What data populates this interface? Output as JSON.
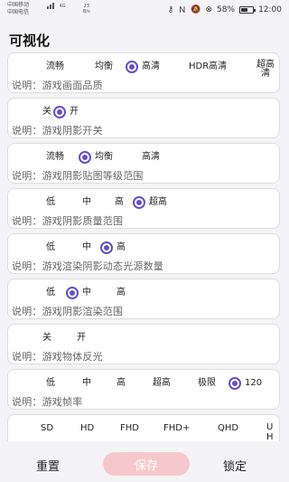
{
  "status_bar": {
    "carrier_1": "中国移动",
    "carrier_2": "中国电信",
    "net_type": "4G",
    "speed_value": "23",
    "speed_unit": "B/s",
    "battery": "58%",
    "battery_level": 0.58,
    "time": "12:00"
  },
  "page_title": "可视化",
  "settings": [
    {
      "options": [
        "流畅",
        "均衡",
        "高清",
        "HDR高清",
        "超高清"
      ],
      "selected": 2,
      "description": "说明：游戏画面品质"
    },
    {
      "options": [
        "关",
        "开"
      ],
      "selected": 1,
      "description": "说明：游戏阴影开关"
    },
    {
      "options": [
        "流畅",
        "均衡",
        "高清"
      ],
      "selected": 1,
      "description": "说明：游戏阴影贴图等级范围"
    },
    {
      "options": [
        "低",
        "中",
        "高",
        "超高"
      ],
      "selected": 3,
      "description": "说明：游戏阴影质量范围"
    },
    {
      "options": [
        "低",
        "中",
        "高"
      ],
      "selected": 2,
      "description": "说明：游戏渲染阴影动态光源数量"
    },
    {
      "options": [
        "低",
        "中",
        "高"
      ],
      "selected": 1,
      "description": "说明：游戏阴影渲染范围"
    },
    {
      "options": [
        "关",
        "开"
      ],
      "selected": -1,
      "description": "说明：游戏物体反光"
    },
    {
      "options": [
        "低",
        "中",
        "高",
        "超高",
        "极限",
        "120"
      ],
      "selected": 5,
      "description": "说明：游戏帧率"
    },
    {
      "options": [
        "SD",
        "HD",
        "FHD",
        "FHD+",
        "QHD",
        "UH"
      ],
      "selected": -1,
      "description": ""
    }
  ],
  "bottom_bar": {
    "reset_label": "重置",
    "save_label": "保存",
    "lock_label": "锁定"
  },
  "colors": {
    "accent": "#6350c9",
    "save_button": "#f7c8cb"
  }
}
